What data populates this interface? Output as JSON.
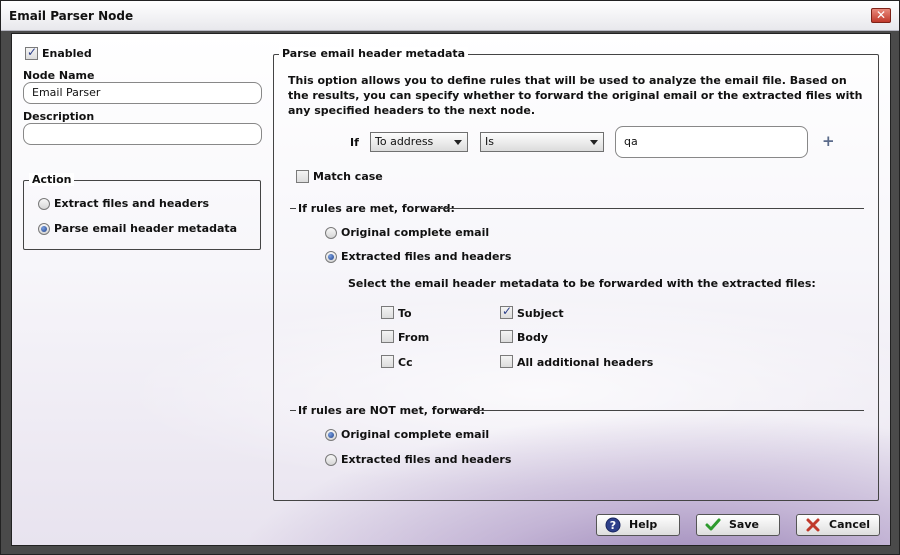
{
  "window": {
    "title": "Email Parser Node"
  },
  "left": {
    "enabled_label": "Enabled",
    "enabled_checked": true,
    "node_name_label": "Node Name",
    "node_name_value": "Email Parser",
    "description_label": "Description",
    "description_value": "",
    "action": {
      "legend": "Action",
      "options": [
        {
          "label": "Extract files and headers",
          "selected": false
        },
        {
          "label": "Parse email header metadata",
          "selected": true
        }
      ]
    }
  },
  "parse": {
    "legend": "Parse email header metadata",
    "intro": "This option allows you to define rules that will be used to analyze the email file. Based on the results, you can specify whether to forward the original email or the extracted files with any specified headers to the next node.",
    "rule": {
      "if_label": "If",
      "field_value": "To address",
      "operator_value": "Is",
      "match_value": "qa",
      "add_glyph": "+"
    },
    "match_case_label": "Match case",
    "match_case_checked": false,
    "met": {
      "heading": "If rules are met, forward:",
      "options": [
        {
          "label": "Original complete email",
          "selected": false
        },
        {
          "label": "Extracted files and headers",
          "selected": true
        }
      ],
      "select_prompt": "Select the email header metadata to be forwarded with the extracted files:",
      "headers": [
        {
          "label": "To",
          "checked": false
        },
        {
          "label": "From",
          "checked": false
        },
        {
          "label": "Cc",
          "checked": false
        },
        {
          "label": "Subject",
          "checked": true
        },
        {
          "label": "Body",
          "checked": false
        },
        {
          "label": "All additional headers",
          "checked": false
        }
      ]
    },
    "not_met": {
      "heading": "If rules are NOT met, forward:",
      "options": [
        {
          "label": "Original complete email",
          "selected": true
        },
        {
          "label": "Extracted files and headers",
          "selected": false
        }
      ]
    }
  },
  "buttons": {
    "help": "Help",
    "save": "Save",
    "cancel": "Cancel"
  },
  "icons": {
    "close": "close-icon",
    "help": "help-icon",
    "save": "checkmark-icon",
    "cancel": "x-icon"
  },
  "colors": {
    "accent": "#2d3f8a",
    "cancel_red": "#c0392b",
    "save_green": "#2e9a2e"
  }
}
